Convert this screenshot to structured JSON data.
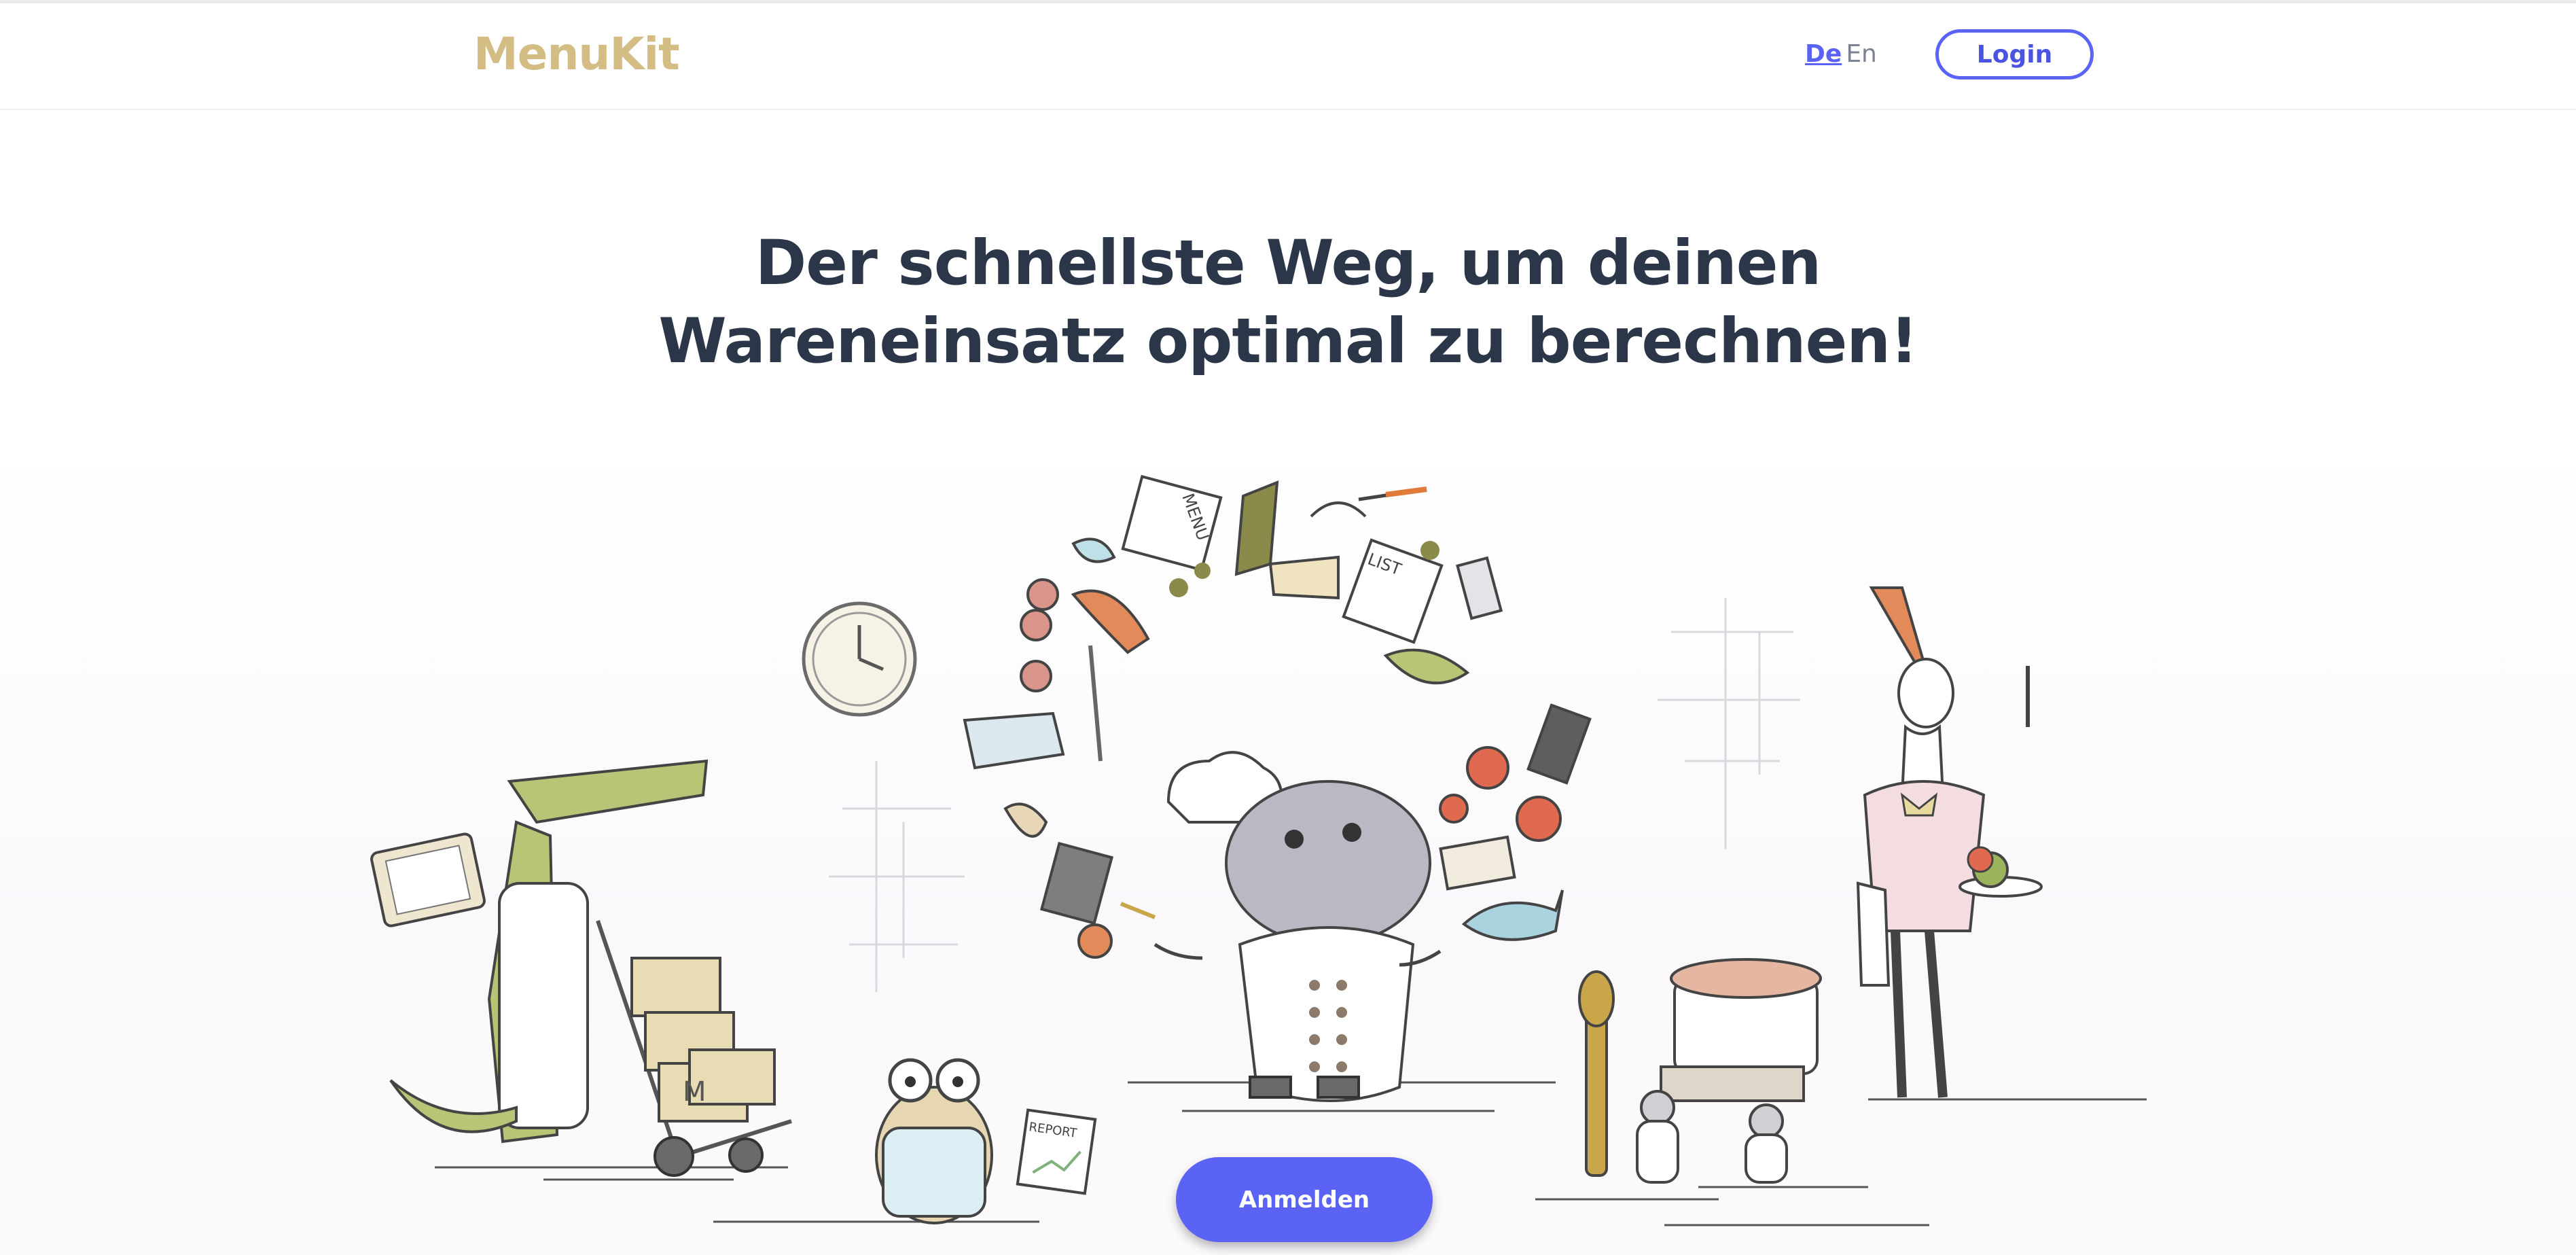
{
  "header": {
    "logo": "MenuKit",
    "lang_de": "De",
    "lang_en": "En",
    "login_label": "Login"
  },
  "hero": {
    "title_line1": "Der schnellste Weg, um deinen",
    "title_line2": "Wareneinsatz optimal zu berechnen!",
    "cta_label": "Anmelden"
  },
  "illustration": {
    "menu_card_text": "MENU",
    "list_card_text": "LIST",
    "report_text": "REPORT",
    "box_letter": "M"
  },
  "colors": {
    "brand_gold": "#d4bd85",
    "accent": "#5b63f5",
    "heading": "#2b3649"
  }
}
